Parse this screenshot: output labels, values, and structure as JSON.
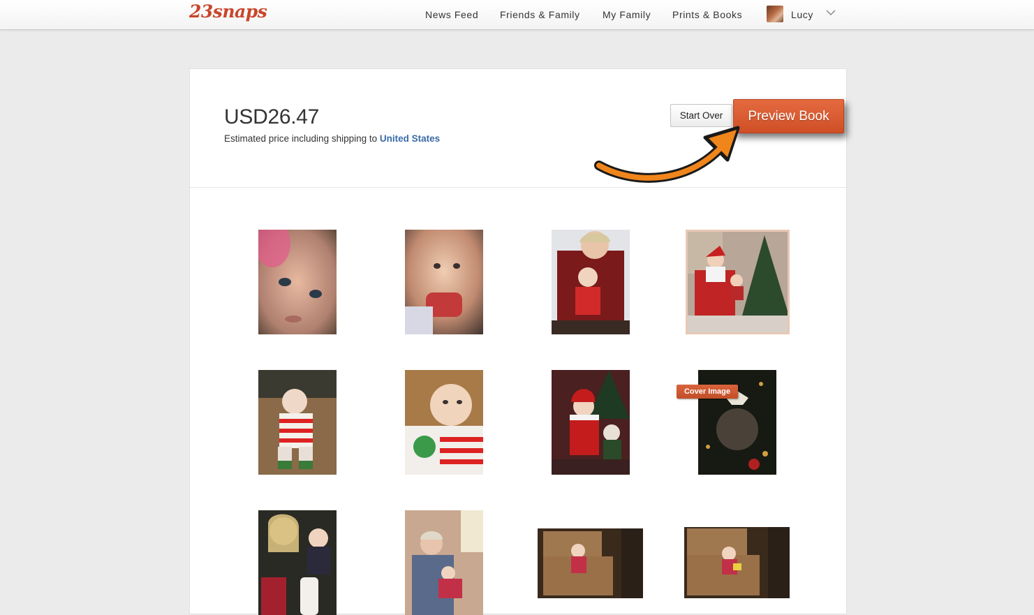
{
  "header": {
    "logo": "23snaps",
    "nav": [
      "News Feed",
      "Friends & Family",
      "My Family",
      "Prints & Books"
    ],
    "user_name": "Lucy"
  },
  "summary": {
    "price": "USD26.47",
    "note": "Estimated price including shipping to",
    "country": "United States"
  },
  "actions": {
    "start_over": "Start Over",
    "preview_book": "Preview Book"
  },
  "cover_badge": "Cover Image",
  "colors": {
    "brand": "#c9462c",
    "button_orange": "#d85a30",
    "arrow_orange": "#f0851c",
    "link_blue": "#3a6aa8"
  }
}
